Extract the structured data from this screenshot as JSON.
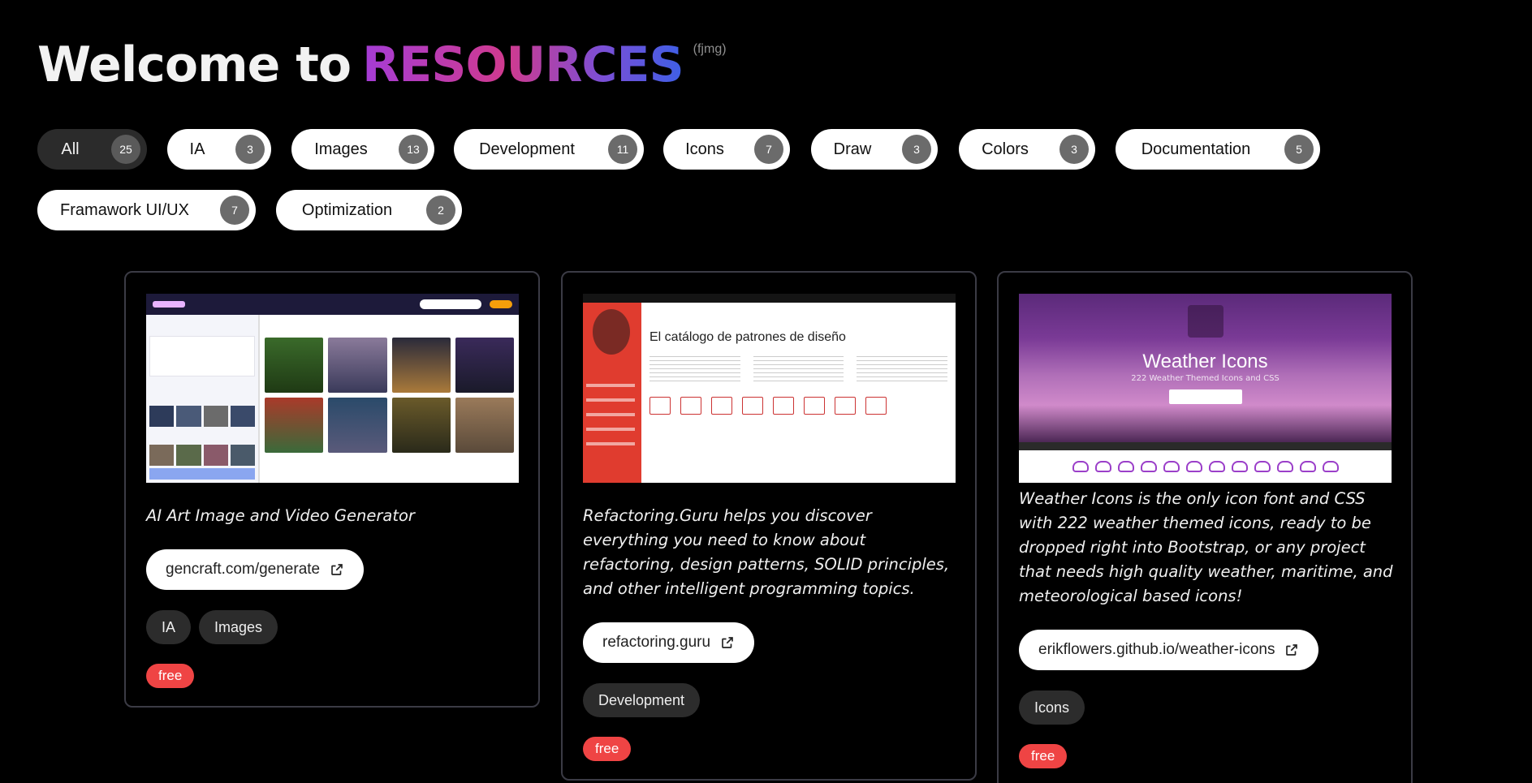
{
  "header": {
    "welcome": "Welcome to",
    "brand": "RESOURCES",
    "tag": "(fjmg)"
  },
  "filters": [
    {
      "label": "All",
      "count": "25",
      "active": true
    },
    {
      "label": "IA",
      "count": "3"
    },
    {
      "label": "Images",
      "count": "13"
    },
    {
      "label": "Development",
      "count": "11"
    },
    {
      "label": "Icons",
      "count": "7"
    },
    {
      "label": "Draw",
      "count": "3"
    },
    {
      "label": "Colors",
      "count": "3"
    },
    {
      "label": "Documentation",
      "count": "5"
    },
    {
      "label": "Framawork UI/UX",
      "count": "7"
    },
    {
      "label": "Optimization",
      "count": "2"
    }
  ],
  "cards": [
    {
      "description": "AI Art Image and Video Generator",
      "link": "gencraft.com/generate",
      "tags": [
        "IA",
        "Images"
      ],
      "price": "free"
    },
    {
      "description": "Refactoring.Guru helps you discover everything you need to know about refactoring, design patterns, SOLID principles, and other intelligent programming topics.",
      "link": "refactoring.guru",
      "tags": [
        "Development"
      ],
      "price": "free",
      "screenshot_heading": "El catálogo de patrones de diseño"
    },
    {
      "description": "Weather Icons is the only icon font and CSS with 222 weather themed icons, ready to be dropped right into Bootstrap, or any project that needs high quality weather, maritime, and meteorological based icons!",
      "link": "erikflowers.github.io/weather-icons",
      "tags": [
        "Icons"
      ],
      "price": "free",
      "screenshot_title": "Weather Icons",
      "screenshot_subtitle": "222 Weather Themed Icons and CSS"
    }
  ],
  "icons": {
    "external_link": "external-link-icon"
  },
  "colors": {
    "background": "#000000",
    "price_badge": "#ef4444",
    "brand_gradient": [
      "#a43cd6",
      "#d03a8e",
      "#3e5fe6"
    ]
  }
}
